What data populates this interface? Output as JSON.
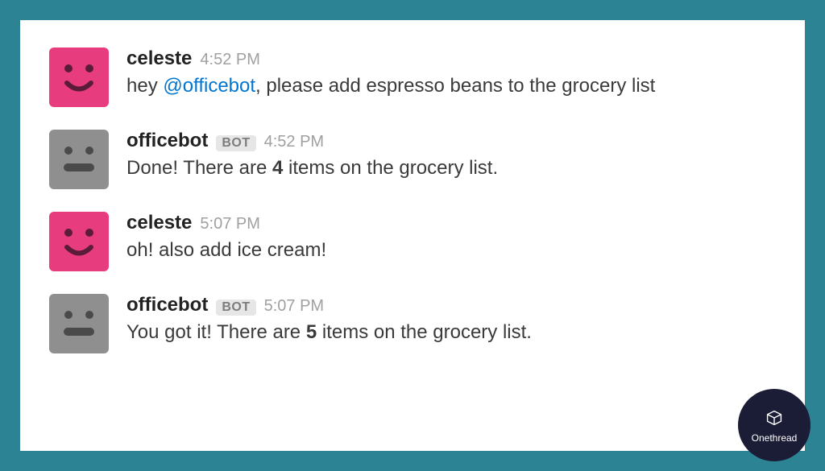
{
  "messages": [
    {
      "user": "celeste",
      "is_bot": false,
      "avatar_color": "pink",
      "time": "4:52 PM",
      "body_before": "hey ",
      "mention": "@officebot",
      "body_after": ", please add espresso beans to the grocery list"
    },
    {
      "user": "officebot",
      "is_bot": true,
      "bot_label": "BOT",
      "avatar_color": "gray",
      "time": "4:52 PM",
      "body_before": "Done! There are ",
      "bold": "4",
      "body_after": " items on the grocery list."
    },
    {
      "user": "celeste",
      "is_bot": false,
      "avatar_color": "pink",
      "time": "5:07 PM",
      "body_plain": "oh! also add ice cream!"
    },
    {
      "user": "officebot",
      "is_bot": true,
      "bot_label": "BOT",
      "avatar_color": "gray",
      "time": "5:07 PM",
      "body_before": "You got it! There are ",
      "bold": "5",
      "body_after": " items on the grocery list."
    }
  ],
  "brand": {
    "name": "Onethread"
  }
}
